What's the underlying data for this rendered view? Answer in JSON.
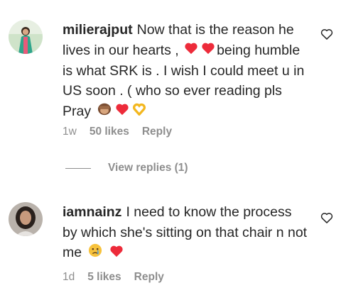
{
  "comments": [
    {
      "username": "milierajput",
      "parts": [
        "Now that is the reason he lives in our hearts ,",
        "being humble is what SRK is . I wish I could meet u in US soon . ( who so ever reading pls Pray"
      ],
      "emojis": [
        "red-heart",
        "red-heart",
        "see-no-evil-monkey",
        "red-heart",
        "heart-hands"
      ],
      "time": "1w",
      "likes": "50 likes",
      "reply": "Reply"
    },
    {
      "username": "iamnainz",
      "parts": [
        "I need to know the process by which she's sitting on that chair n not me"
      ],
      "emojis": [
        "crying-face",
        "red-heart"
      ],
      "time": "1d",
      "likes": "5 likes",
      "reply": "Reply"
    }
  ],
  "view_replies": "View replies (1)",
  "colors": {
    "text": "#262626",
    "muted": "#8e8e8e",
    "heart": "#ed2b3a"
  }
}
